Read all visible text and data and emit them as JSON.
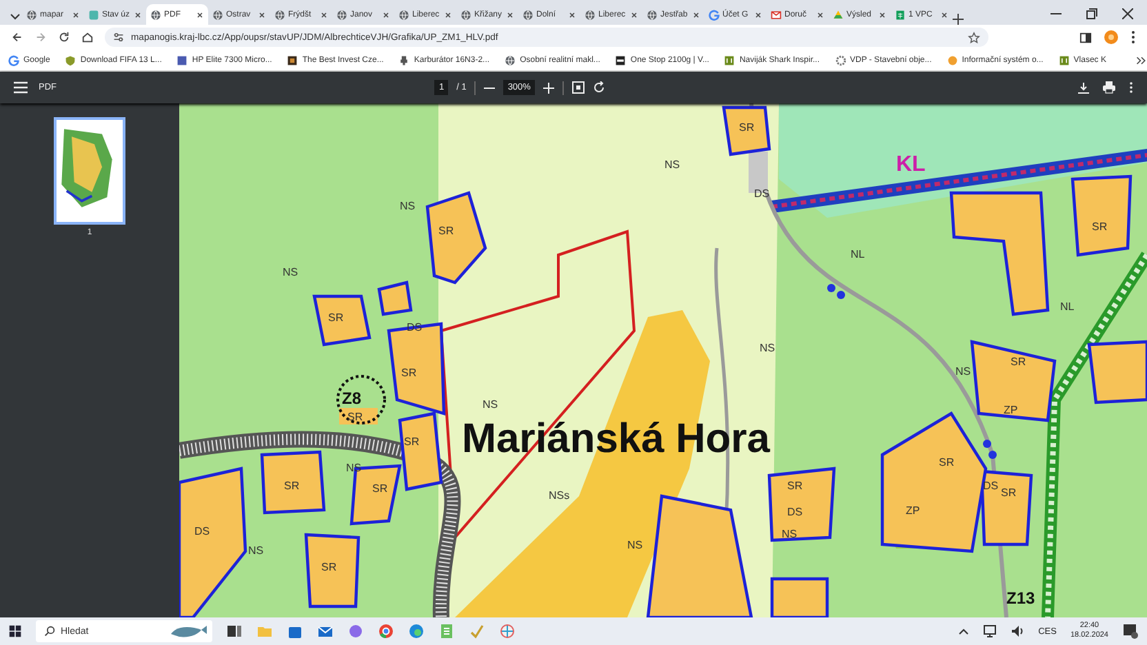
{
  "browser": {
    "tabs": [
      {
        "label": "mapar",
        "selected": false
      },
      {
        "label": "Stav úz",
        "selected": false
      },
      {
        "label": "PDF",
        "selected": true
      },
      {
        "label": "Ostrav",
        "selected": false
      },
      {
        "label": "Frýdšt",
        "selected": false
      },
      {
        "label": "Janov",
        "selected": false
      },
      {
        "label": "Liberec",
        "selected": false
      },
      {
        "label": "Křižany",
        "selected": false
      },
      {
        "label": "Dolní",
        "selected": false
      },
      {
        "label": "Liberec",
        "selected": false
      },
      {
        "label": "Jestřab",
        "selected": false
      },
      {
        "label": "Účet G",
        "selected": false
      },
      {
        "label": "Doruč",
        "selected": false
      },
      {
        "label": "Výsled",
        "selected": false
      },
      {
        "label": "1 VPC",
        "selected": false
      }
    ],
    "address_bar": {
      "url": "mapanogis.kraj-lbc.cz/App/oupsr/stavUP/JDM/AlbrechticeVJH/Grafika/UP_ZM1_HLV.pdf"
    },
    "bookmarks": [
      "Google",
      "Download FIFA 13 L...",
      "HP Elite 7300 Micro...",
      "The Best Invest Cze...",
      "Karburátor 16N3-2...",
      "Osobní realitní makl...",
      "One Stop 2100g | V...",
      "Naviják Shark Inspir...",
      "VDP - Stavební obje...",
      "Informační systém o...",
      "Vlasec K"
    ]
  },
  "pdf_viewer": {
    "title": "PDF",
    "page_current": "1",
    "page_total": "/ 1",
    "zoom": "300%",
    "thumbnails": [
      {
        "label": "1",
        "selected": true
      }
    ],
    "map": {
      "labels": [
        {
          "text": "Mariánská Hora",
          "kind": "place-name"
        },
        {
          "text": "KL",
          "kind": "area-code"
        },
        {
          "text": "Z8",
          "kind": "plot-code"
        },
        {
          "text": "Z13",
          "kind": "plot-code"
        },
        {
          "text": "NS",
          "kind": "zone"
        },
        {
          "text": "NS",
          "kind": "zone"
        },
        {
          "text": "NS",
          "kind": "zone"
        },
        {
          "text": "NS",
          "kind": "zone"
        },
        {
          "text": "NS",
          "kind": "zone"
        },
        {
          "text": "NS",
          "kind": "zone"
        },
        {
          "text": "NS",
          "kind": "zone"
        },
        {
          "text": "NS",
          "kind": "zone"
        },
        {
          "text": "NSs",
          "kind": "zone"
        },
        {
          "text": "NS",
          "kind": "zone"
        },
        {
          "text": "NS",
          "kind": "zone"
        },
        {
          "text": "SR",
          "kind": "zone"
        },
        {
          "text": "SR",
          "kind": "zone"
        },
        {
          "text": "SR",
          "kind": "zone"
        },
        {
          "text": "SR",
          "kind": "zone"
        },
        {
          "text": "SR",
          "kind": "zone"
        },
        {
          "text": "SR",
          "kind": "zone"
        },
        {
          "text": "SR",
          "kind": "zone"
        },
        {
          "text": "SR",
          "kind": "zone"
        },
        {
          "text": "SR",
          "kind": "zone"
        },
        {
          "text": "SR",
          "kind": "zone"
        },
        {
          "text": "SR",
          "kind": "zone"
        },
        {
          "text": "SR",
          "kind": "zone"
        },
        {
          "text": "SR",
          "kind": "zone"
        },
        {
          "text": "SR",
          "kind": "zone"
        },
        {
          "text": "DS",
          "kind": "zone"
        },
        {
          "text": "DS",
          "kind": "zone"
        },
        {
          "text": "DS",
          "kind": "zone"
        },
        {
          "text": "DS",
          "kind": "zone"
        },
        {
          "text": "DS",
          "kind": "zone"
        },
        {
          "text": "NL",
          "kind": "zone"
        },
        {
          "text": "NL",
          "kind": "zone"
        },
        {
          "text": "ZP",
          "kind": "zone"
        },
        {
          "text": "ZP",
          "kind": "zone"
        }
      ]
    }
  },
  "taskbar": {
    "search": {
      "placeholder": "Hledat"
    },
    "language": "CES",
    "time": "22:40",
    "date": "18.02.2024"
  }
}
